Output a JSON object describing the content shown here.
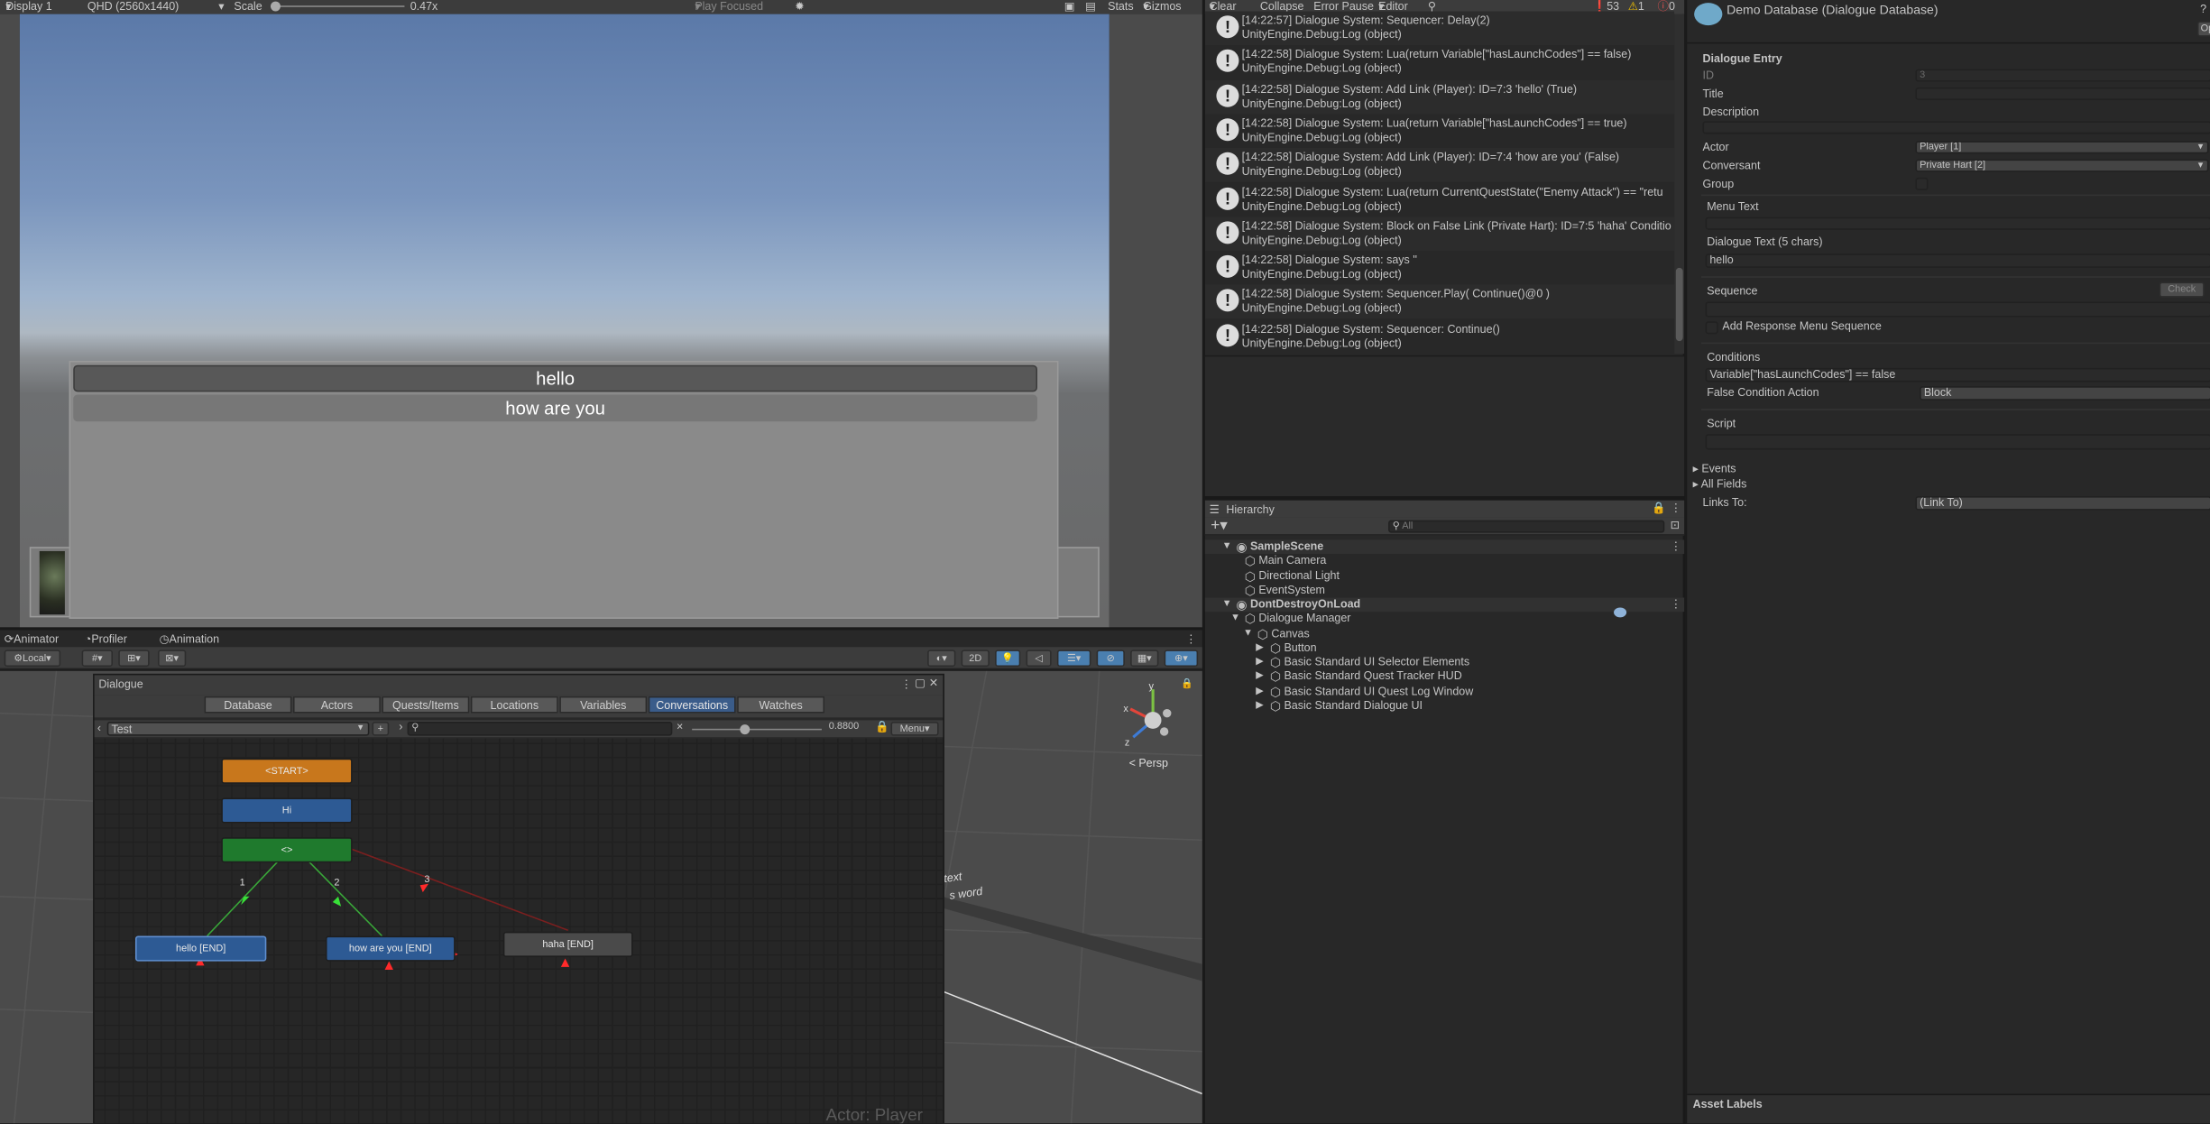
{
  "game_toolbar": {
    "display": "Display 1",
    "resolution": "QHD (2560x1440)",
    "scale_label": "Scale",
    "scale_value": "0.47x",
    "play_focused": "Play Focused",
    "stats": "Stats",
    "gizmos": "Gizmos"
  },
  "game_view": {
    "responses": [
      "hello",
      "how are you"
    ]
  },
  "bottom_tabs": [
    "Animator",
    "Profiler",
    "Animation"
  ],
  "scene_toolbar": {
    "pivot": "Local",
    "mode_2d": "2D",
    "persp": "< Persp"
  },
  "dialogue_editor": {
    "title": "Dialogue",
    "tabs": [
      "Database",
      "Actors",
      "Quests/Items",
      "Locations",
      "Variables",
      "Conversations",
      "Watches"
    ],
    "active_tab": "Conversations",
    "conversation": "Test",
    "zoom": "0.8800",
    "menu": "Menu",
    "nodes": {
      "start": "<START>",
      "hi": "Hi",
      "group": "<>",
      "hello": "hello [END]",
      "how": "how are you [END]",
      "haha": "haha [END]"
    },
    "link_labels": [
      "1",
      "2",
      "3"
    ],
    "actor_label": "Actor: Player"
  },
  "console": {
    "toolbar": {
      "clear": "Clear",
      "collapse": "Collapse",
      "error_pause": "Error Pause",
      "editor": "Editor",
      "count_info": "53",
      "count_warn": "1",
      "count_error": "0"
    },
    "logs": [
      {
        "line1": "[14:22:57] Dialogue System: Sequencer: Delay(2)",
        "line2": "UnityEngine.Debug:Log (object)"
      },
      {
        "line1": "[14:22:58] Dialogue System: Lua(return Variable[\"hasLaunchCodes\"] == false)",
        "line2": "UnityEngine.Debug:Log (object)"
      },
      {
        "line1": "[14:22:58] Dialogue System: Add Link (Player): ID=7:3 'hello' (True)",
        "line2": "UnityEngine.Debug:Log (object)"
      },
      {
        "line1": "[14:22:58] Dialogue System: Lua(return Variable[\"hasLaunchCodes\"] == true)",
        "line2": "UnityEngine.Debug:Log (object)"
      },
      {
        "line1": "[14:22:58] Dialogue System: Add Link (Player): ID=7:4 'how are you' (False)",
        "line2": "UnityEngine.Debug:Log (object)"
      },
      {
        "line1": "[14:22:58] Dialogue System: Lua(return CurrentQuestState(\"Enemy Attack\") == \"retu",
        "line2": "UnityEngine.Debug:Log (object)"
      },
      {
        "line1": "[14:22:58] Dialogue System: Block on False Link (Private Hart): ID=7:5 'haha' Conditio",
        "line2": "UnityEngine.Debug:Log (object)"
      },
      {
        "line1": "[14:22:58] Dialogue System: says ''",
        "line2": "UnityEngine.Debug:Log (object)"
      },
      {
        "line1": "[14:22:58] Dialogue System: Sequencer.Play( Continue()@0 )",
        "line2": "UnityEngine.Debug:Log (object)"
      },
      {
        "line1": "[14:22:58] Dialogue System: Sequencer: Continue()",
        "line2": "UnityEngine.Debug:Log (object)"
      }
    ]
  },
  "hierarchy": {
    "title": "Hierarchy",
    "search_placeholder": "All",
    "items": [
      {
        "label": "SampleScene",
        "depth": 0,
        "type": "scene",
        "arrow": "▼"
      },
      {
        "label": "Main Camera",
        "depth": 1,
        "type": "obj",
        "arrow": ""
      },
      {
        "label": "Directional Light",
        "depth": 1,
        "type": "obj",
        "arrow": ""
      },
      {
        "label": "EventSystem",
        "depth": 1,
        "type": "obj",
        "arrow": ""
      },
      {
        "label": "DontDestroyOnLoad",
        "depth": 0,
        "type": "scene",
        "arrow": "▼"
      },
      {
        "label": "Dialogue Manager",
        "depth": 1,
        "type": "obj",
        "arrow": "▼"
      },
      {
        "label": "Canvas",
        "depth": 2,
        "type": "obj",
        "arrow": "▼"
      },
      {
        "label": "Button",
        "depth": 3,
        "type": "obj",
        "arrow": "▶"
      },
      {
        "label": "Basic Standard UI Selector Elements",
        "depth": 3,
        "type": "obj",
        "arrow": "▶"
      },
      {
        "label": "Basic Standard Quest Tracker HUD",
        "depth": 3,
        "type": "obj",
        "arrow": "▶"
      },
      {
        "label": "Basic Standard UI Quest Log Window",
        "depth": 3,
        "type": "obj",
        "arrow": "▶"
      },
      {
        "label": "Basic Standard Dialogue UI",
        "depth": 3,
        "type": "obj",
        "arrow": "▶"
      }
    ]
  },
  "inspector": {
    "header": "Demo Database (Dialogue Database)",
    "section": "Dialogue Entry",
    "id_label": "ID",
    "id_value": "3",
    "title_label": "Title",
    "description_label": "Description",
    "actor_label": "Actor",
    "actor_value": "Player [1]",
    "conversant_label": "Conversant",
    "conversant_value": "Private Hart [2]",
    "group_label": "Group",
    "menu_text_label": "Menu Text",
    "dialogue_text_label": "Dialogue Text (5 chars)",
    "dialogue_text_value": "hello",
    "sequence_label": "Sequence",
    "check_button": "Check",
    "add_response_label": "Add Response Menu Sequence",
    "conditions_label": "Conditions",
    "conditions_value": "Variable[\"hasLaunchCodes\"] == false",
    "false_action_label": "False Condition Action",
    "false_action_value": "Block",
    "script_label": "Script",
    "events_label": "Events",
    "all_fields_label": "All Fields",
    "links_to_label": "Links To:",
    "links_to_value": "(Link To)",
    "asset_labels": "Asset Labels"
  }
}
